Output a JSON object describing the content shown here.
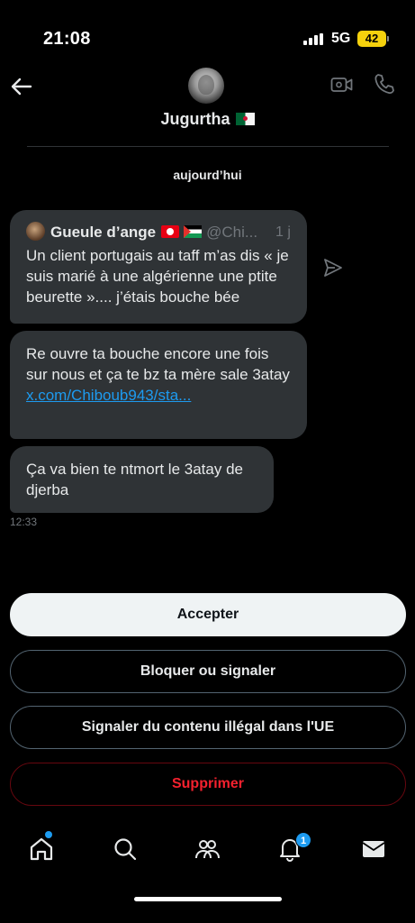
{
  "status_bar": {
    "time": "21:08",
    "network": "5G",
    "battery": "42"
  },
  "header": {
    "contact_name": "Jugurtha",
    "back_icon": "arrow-left-icon",
    "video_icon": "video-call-icon",
    "phone_icon": "phone-call-icon"
  },
  "conversation": {
    "date_separator": "aujourd’hui",
    "quoted_post": {
      "author": "Gueule d’ange",
      "handle": "@Chi...",
      "age": "1 j",
      "text": "Un client portugais au taff m’as dis « je suis marié à une algérienne une ptite beurette ».... j’étais bouche bée"
    },
    "messages": [
      {
        "text": "Re ouvre ta bouche encore une fois sur nous et ça te bz ta mère sale 3atay",
        "link": "x.com/Chiboub943/sta..."
      },
      {
        "text": "Ça va bien te ntmort le 3atay de djerba"
      }
    ],
    "timestamp": "12:33"
  },
  "actions": {
    "accept": "Accepter",
    "block": "Bloquer ou signaler",
    "report_eu": "Signaler du contenu illégal dans l'UE",
    "delete": "Supprimer"
  },
  "tab_bar": {
    "items": [
      {
        "name": "home",
        "icon": "home-icon"
      },
      {
        "name": "search",
        "icon": "search-icon"
      },
      {
        "name": "communities",
        "icon": "communities-icon"
      },
      {
        "name": "notifications",
        "icon": "bell-icon"
      },
      {
        "name": "messages",
        "icon": "envelope-icon"
      }
    ],
    "notifications_badge": "1"
  },
  "colors": {
    "background": "#000000",
    "bubble": "#2f3336",
    "accent": "#1d9bf0",
    "danger": "#f4212e",
    "muted": "#71767b"
  }
}
